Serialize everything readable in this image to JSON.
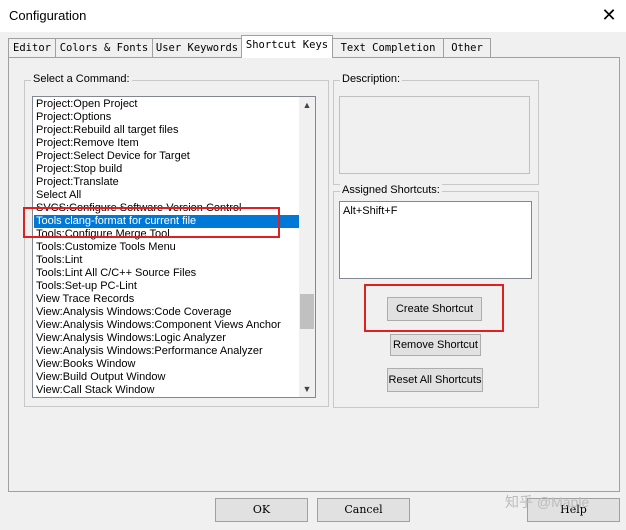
{
  "window": {
    "title": "Configuration",
    "close_glyph": "✕"
  },
  "tabs": [
    "Editor",
    "Colors & Fonts",
    "User Keywords",
    "Shortcut Keys",
    "Text Completion",
    "Other"
  ],
  "active_tab": "Shortcut Keys",
  "commands": {
    "label": "Select a Command:",
    "items": [
      "Project:Open Project",
      "Project:Options",
      "Project:Rebuild all target files",
      "Project:Remove Item",
      "Project:Select Device for Target",
      "Project:Stop build",
      "Project:Translate",
      "Select All",
      "SVCS:Configure Software Version Control",
      "Tools clang-format for current file",
      "Tools:Configure Merge Tool",
      "Tools:Customize Tools Menu",
      "Tools:Lint",
      "Tools:Lint All C/C++ Source Files",
      "Tools:Set-up PC-Lint",
      "View Trace Records",
      "View:Analysis Windows:Code Coverage",
      "View:Analysis Windows:Component Views Anchor",
      "View:Analysis Windows:Logic Analyzer",
      "View:Analysis Windows:Performance Analyzer",
      "View:Books Window",
      "View:Build Output Window",
      "View:Call Stack Window"
    ],
    "selected": "Tools clang-format for current file",
    "scroll_up_glyph": "▲",
    "scroll_down_glyph": "▼"
  },
  "description": {
    "label": "Description:",
    "text": ""
  },
  "assigned": {
    "label": "Assigned Shortcuts:",
    "items": [
      "Alt+Shift+F"
    ]
  },
  "buttons": {
    "create": "Create Shortcut",
    "remove": "Remove Shortcut",
    "reset": "Reset All Shortcuts",
    "ok": "OK",
    "cancel": "Cancel",
    "help": "Help"
  },
  "watermark": "知乎 @Maple",
  "colors": {
    "selection": "#0078d7",
    "highlight": "#e02020"
  }
}
